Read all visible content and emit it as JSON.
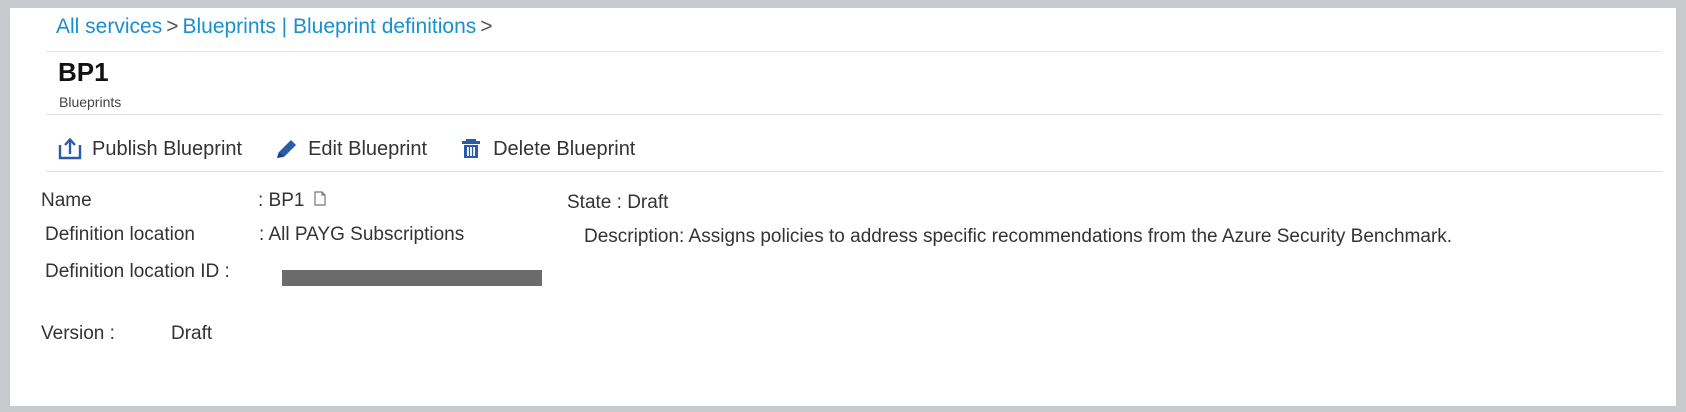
{
  "breadcrumb": {
    "all_services": "All services",
    "sep1": ">",
    "blueprints": "Blueprints | Blueprint definitions",
    "sep2": ">"
  },
  "header": {
    "title": "BP1",
    "subtitle": "Blueprints"
  },
  "toolbar": {
    "publish_label": "Publish Blueprint",
    "edit_label": "Edit Blueprint",
    "delete_label": "Delete Blueprint"
  },
  "icons": {
    "publish": "upload-icon",
    "edit": "pencil-icon",
    "delete": "trash-icon",
    "copy": "copy-icon"
  },
  "colors": {
    "link": "#1a8fd0",
    "icon": "#2b5ba8",
    "redacted": "#6b6b6b"
  },
  "details": {
    "name_label": "Name",
    "name_value": ": BP1",
    "def_location_label": "Definition location",
    "def_location_value": ":   All PAYG Subscriptions",
    "def_location_id_label": "Definition location ID :",
    "version_label": "Version :",
    "version_value": "Draft",
    "state": "State : Draft",
    "description": "Description: Assigns policies to address specific recommendations from the Azure Security Benchmark."
  }
}
